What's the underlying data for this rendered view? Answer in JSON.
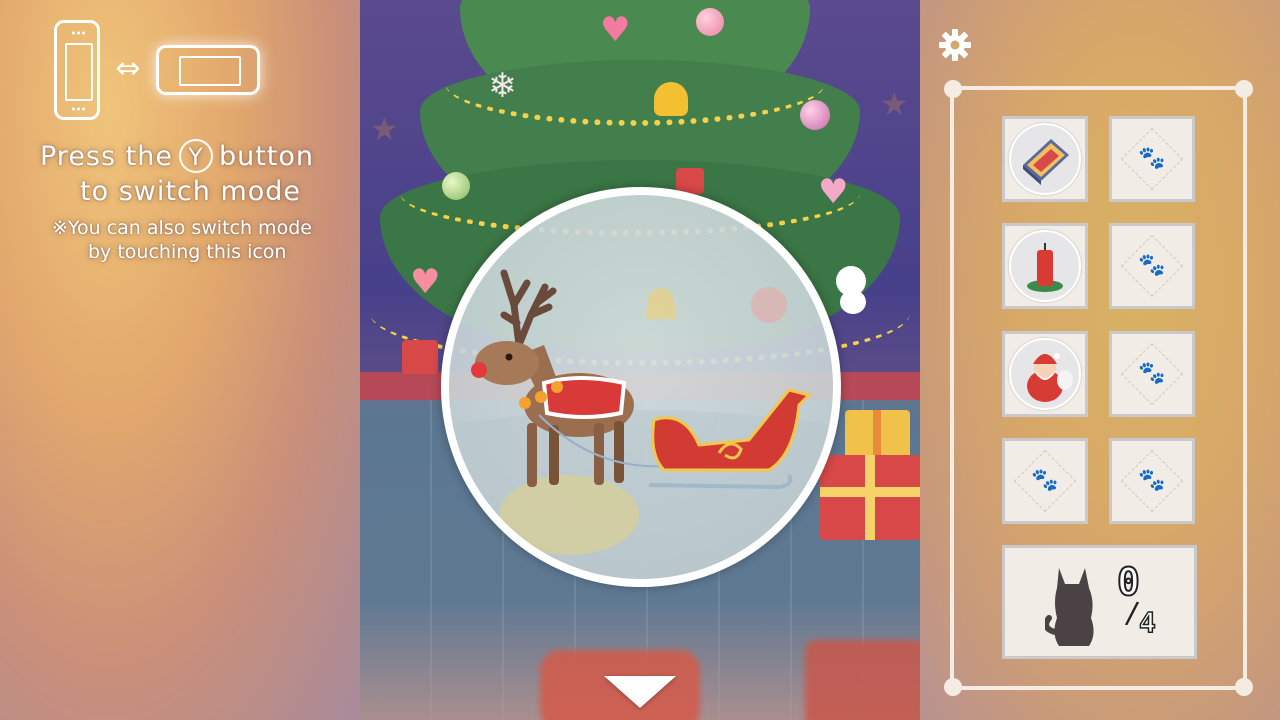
{
  "mode_hint": {
    "line1_prefix": "Press the",
    "button_letter": "Y",
    "line1_suffix": "button",
    "line2": "to switch mode",
    "note_line1": "※You can also switch mode",
    "note_line2": "by touching this icon",
    "swap_symbol": "⇔",
    "icons": [
      "handheld-mode-icon",
      "tv-mode-icon"
    ]
  },
  "scene": {
    "lens_subject": "reindeer-and-sleigh",
    "scroll_icon": "scroll-down-arrow-icon"
  },
  "inventory": {
    "settings_icon": "gear-icon",
    "slots": [
      {
        "state": "filled",
        "item": "matchbox-icon"
      },
      {
        "state": "empty",
        "item": "paw-placeholder-icon"
      },
      {
        "state": "filled",
        "item": "red-candle-icon"
      },
      {
        "state": "empty",
        "item": "paw-placeholder-icon"
      },
      {
        "state": "filled",
        "item": "santa-figure-icon"
      },
      {
        "state": "empty",
        "item": "paw-placeholder-icon"
      },
      {
        "state": "empty",
        "item": "paw-placeholder-icon"
      },
      {
        "state": "empty",
        "item": "paw-placeholder-icon"
      }
    ],
    "cats_found": "0",
    "cats_total": "4",
    "cat_icon": "black-cat-icon"
  },
  "colors": {
    "accent_white": "#ffffff",
    "slot_bg": "#f1ede6",
    "tree_green": "#3f7b4a",
    "garland_gold": "#f6d24a"
  }
}
